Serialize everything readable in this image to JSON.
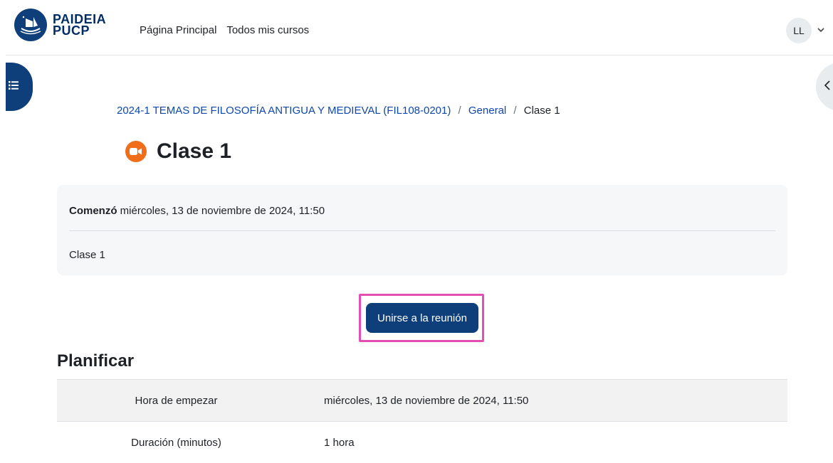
{
  "brand": {
    "line1": "PAIDEIA",
    "line2": "PUCP",
    "color": "#002d66"
  },
  "nav": {
    "home": "Página Principal",
    "courses": "Todos mis cursos"
  },
  "user": {
    "initials": "LL"
  },
  "breadcrumb": {
    "course": "2024-1 TEMAS DE FILOSOFÍA ANTIGUA Y MEDIEVAL (FIL108-0201)",
    "separator": "/",
    "section": "General",
    "current": "Clase 1"
  },
  "activity": {
    "title": "Clase 1",
    "icon": "zoom-video-icon",
    "icon_color": "#f06d1a"
  },
  "info": {
    "start_label": "Comenzó",
    "start_value": " miércoles, 13 de noviembre de 2024, 11:50",
    "description": "Clase 1"
  },
  "join_button": {
    "label": "Unirse a la reunión",
    "color": "#0f3f7a",
    "highlight_color": "#e24fb1"
  },
  "schedule": {
    "title": "Planificar",
    "rows": [
      {
        "label": "Hora de empezar",
        "value": "miércoles, 13 de noviembre de 2024, 11:50"
      },
      {
        "label": "Duración (minutos)",
        "value": "1 hora"
      }
    ]
  }
}
